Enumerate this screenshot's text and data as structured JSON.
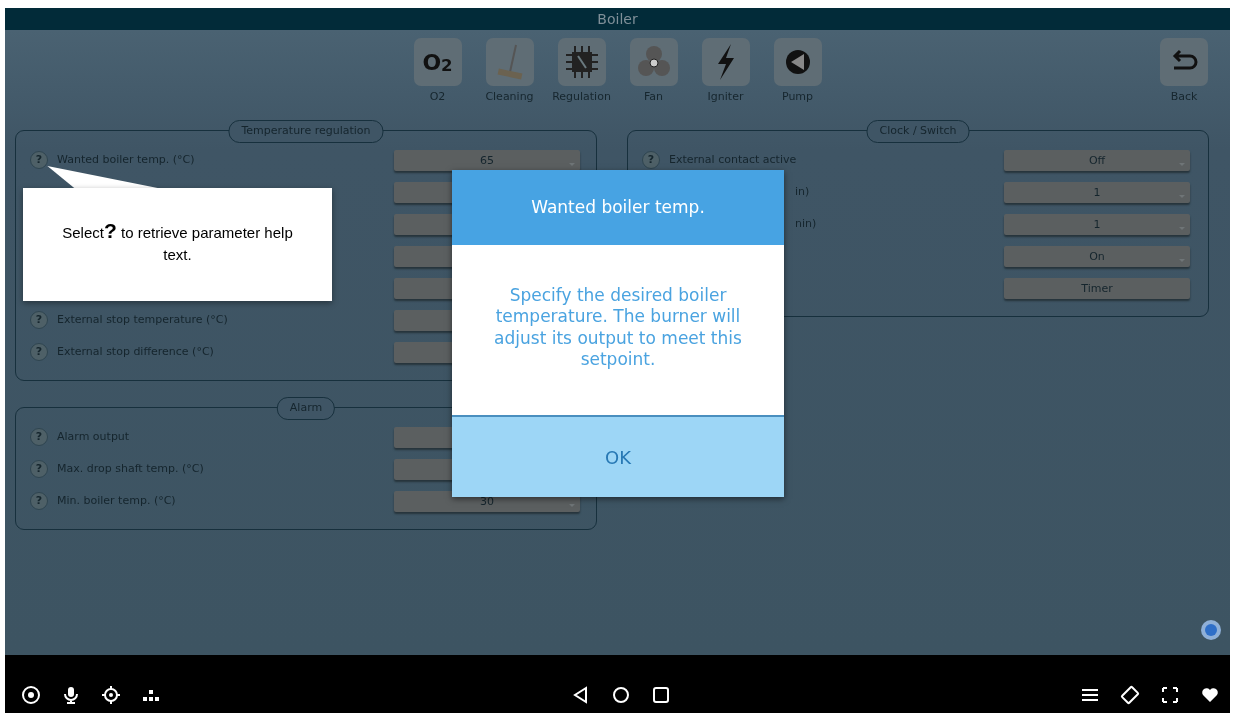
{
  "window": {
    "title": "Boiler"
  },
  "toolbar": [
    {
      "kind": "o2",
      "label": "O2",
      "glyph": "O$_{2}$"
    },
    {
      "kind": "broom",
      "label": "Cleaning"
    },
    {
      "kind": "chip",
      "label": "Regulation"
    },
    {
      "kind": "fan",
      "label": "Fan"
    },
    {
      "kind": "bolt",
      "label": "Igniter"
    },
    {
      "kind": "pump",
      "label": "Pump"
    }
  ],
  "back": {
    "label": "Back"
  },
  "left_panels": [
    {
      "title": "Temperature regulation",
      "rows": [
        {
          "help": "?",
          "label": "Wanted boiler temp. (°C)",
          "value": "65"
        },
        {},
        {},
        {},
        {},
        {
          "help": "?",
          "label": "External stop temperature (°C)"
        },
        {
          "help": "?",
          "label": "External stop difference (°C)"
        }
      ]
    },
    {
      "title": "Alarm",
      "rows": [
        {
          "help": "?",
          "label": "Alarm output"
        },
        {
          "help": "?",
          "label": "Max. drop shaft temp. (°C)"
        },
        {
          "help": "?",
          "label": "Min. boiler temp. (°C)",
          "value": "30"
        }
      ]
    }
  ],
  "right_panel": {
    "title": "Clock / Switch",
    "rows": [
      {
        "help": "?",
        "label": "External contact active",
        "value": "Off",
        "kind": "select"
      },
      {
        "label": "in)",
        "value": "1",
        "kind": "select",
        "cut": true
      },
      {
        "label": "nin)",
        "value": "1",
        "kind": "select",
        "cut": true
      },
      {
        "value": "On",
        "kind": "select"
      },
      {
        "value": "Timer",
        "kind": "button"
      }
    ]
  },
  "dialog": {
    "title": "Wanted boiler temp.",
    "message": "Specify the desired boiler temperature. The burner will adjust its output to meet this setpoint.",
    "ok": "OK"
  },
  "callout": {
    "text": "Select**?** to retrieve parameter help text."
  }
}
